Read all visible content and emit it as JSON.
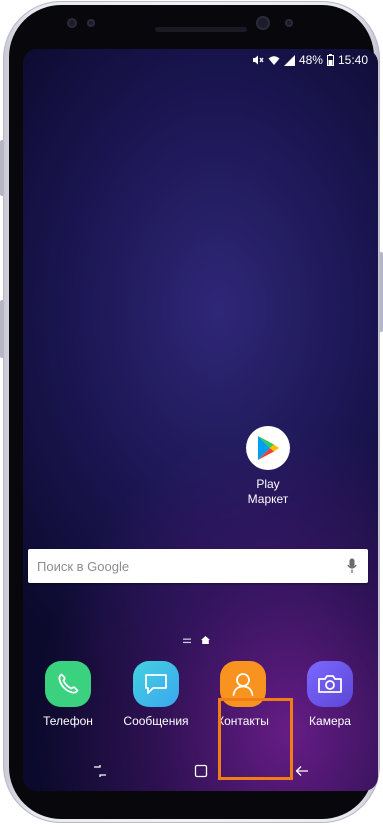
{
  "status_bar": {
    "battery_percent": "48%",
    "time": "15:40",
    "icons": [
      "mute-icon",
      "wifi-icon",
      "signal-icon",
      "battery-icon"
    ]
  },
  "home_screen": {
    "play_market": {
      "label": "Play\nМаркет",
      "icon": "play-store-icon"
    },
    "search": {
      "placeholder": "Поиск в Google",
      "icon": "mic-icon"
    }
  },
  "dock": {
    "apps": [
      {
        "label": "Телефон",
        "icon": "phone-icon",
        "color": "#3ad17f"
      },
      {
        "label": "Сообщения",
        "icon": "message-icon",
        "color": "#3cc1e6"
      },
      {
        "label": "Контакты",
        "icon": "contact-icon",
        "color": "#f7931e"
      },
      {
        "label": "Камера",
        "icon": "camera-icon",
        "color": "#6a55e0"
      }
    ]
  },
  "highlight": {
    "target": "Контакты",
    "color": "#f07d15"
  },
  "nav_bar": {
    "buttons": [
      "recents-icon",
      "home-icon",
      "back-icon"
    ]
  },
  "colors": {
    "wallpaper_top": "#0b0a2c",
    "wallpaper_glow": "#762096"
  }
}
